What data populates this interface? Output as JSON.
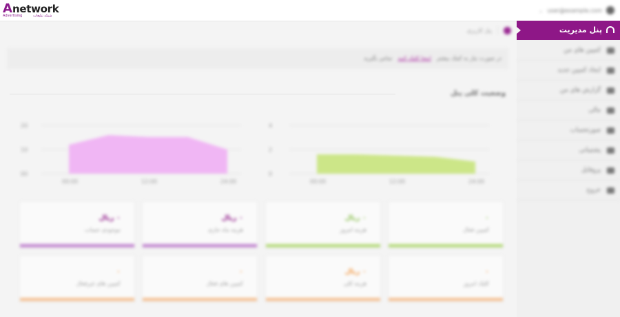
{
  "brand": {
    "logo_mark": "A",
    "logo_text": "network",
    "logo_sub_en": "Advertising",
    "logo_sub_fa": "شبکه تبلیغات"
  },
  "header": {
    "user_name": "user@example.com",
    "chevron": "⌄"
  },
  "sidebar": {
    "active": {
      "label": "پنل مدیریت",
      "icon": "dashboard-icon"
    },
    "items": [
      {
        "label": "کمپین های من",
        "icon": "megaphone-icon"
      },
      {
        "label": "ایجاد کمپین جدید",
        "icon": "plus-icon"
      },
      {
        "label": "گزارش های من",
        "icon": "chart-icon"
      },
      {
        "label": "مالی",
        "icon": "wallet-icon"
      },
      {
        "label": "صورتحساب",
        "icon": "invoice-icon"
      },
      {
        "label": "پشتیبانی",
        "icon": "support-icon"
      },
      {
        "label": "پروفایل",
        "icon": "user-icon"
      },
      {
        "label": "خروج",
        "icon": "logout-icon"
      }
    ]
  },
  "breadcrumb": {
    "home_label": "پنل کاربری"
  },
  "notice": {
    "text": "در صورت نیاز به کمک بیشتر",
    "link": "اینجا کلیک کنید",
    "suffix": "تماس بگیرید"
  },
  "dashboard": {
    "section_title": "وضعیت کلی پنل"
  },
  "colors": {
    "brand": "#8e1787",
    "chart_left": "#f0b6f4",
    "chart_right": "#cce688",
    "bar_purple": "#c58bd2",
    "bar_green": "#b9dc82",
    "bar_orange": "#f5c59a"
  },
  "chart_data": [
    {
      "type": "area",
      "x": [
        "00:00",
        "12:00",
        "24:00"
      ],
      "values": [
        30,
        40,
        38,
        38,
        25
      ],
      "ylim": [
        0,
        50
      ],
      "yticks": [
        "20",
        "10",
        "00"
      ],
      "xlabel": "",
      "ylabel": "",
      "title": ""
    },
    {
      "type": "area",
      "x": [
        "00:00",
        "12:00",
        "24:00"
      ],
      "values": [
        8,
        8,
        7.5,
        7,
        5
      ],
      "ylim": [
        0,
        20
      ],
      "yticks": [
        "4",
        "2",
        "0"
      ],
      "xlabel": "",
      "ylabel": "",
      "title": ""
    }
  ],
  "cards_row1": [
    {
      "value": "۰ ریال",
      "label": "موجودی حساب",
      "color": "#8e1787"
    },
    {
      "value": "۰ ریال",
      "label": "هزینه ماه جاری",
      "color": "#8e1787"
    },
    {
      "value": "۰ ریال",
      "label": "هزینه امروز",
      "color": "#8cc152"
    },
    {
      "value": "۰",
      "label": "کمپین فعال",
      "color": "#8cc152"
    }
  ],
  "cards_row2": [
    {
      "value": "۰",
      "label": "کمپین های غیرفعال",
      "color": "#f39c4a"
    },
    {
      "value": "۰",
      "label": "کمپین های فعال",
      "color": "#f39c4a"
    },
    {
      "value": "۰ ریال",
      "label": "هزینه کلی",
      "color": "#f39c4a"
    },
    {
      "value": "۰",
      "label": "کلیک امروز",
      "color": "#f39c4a"
    }
  ]
}
